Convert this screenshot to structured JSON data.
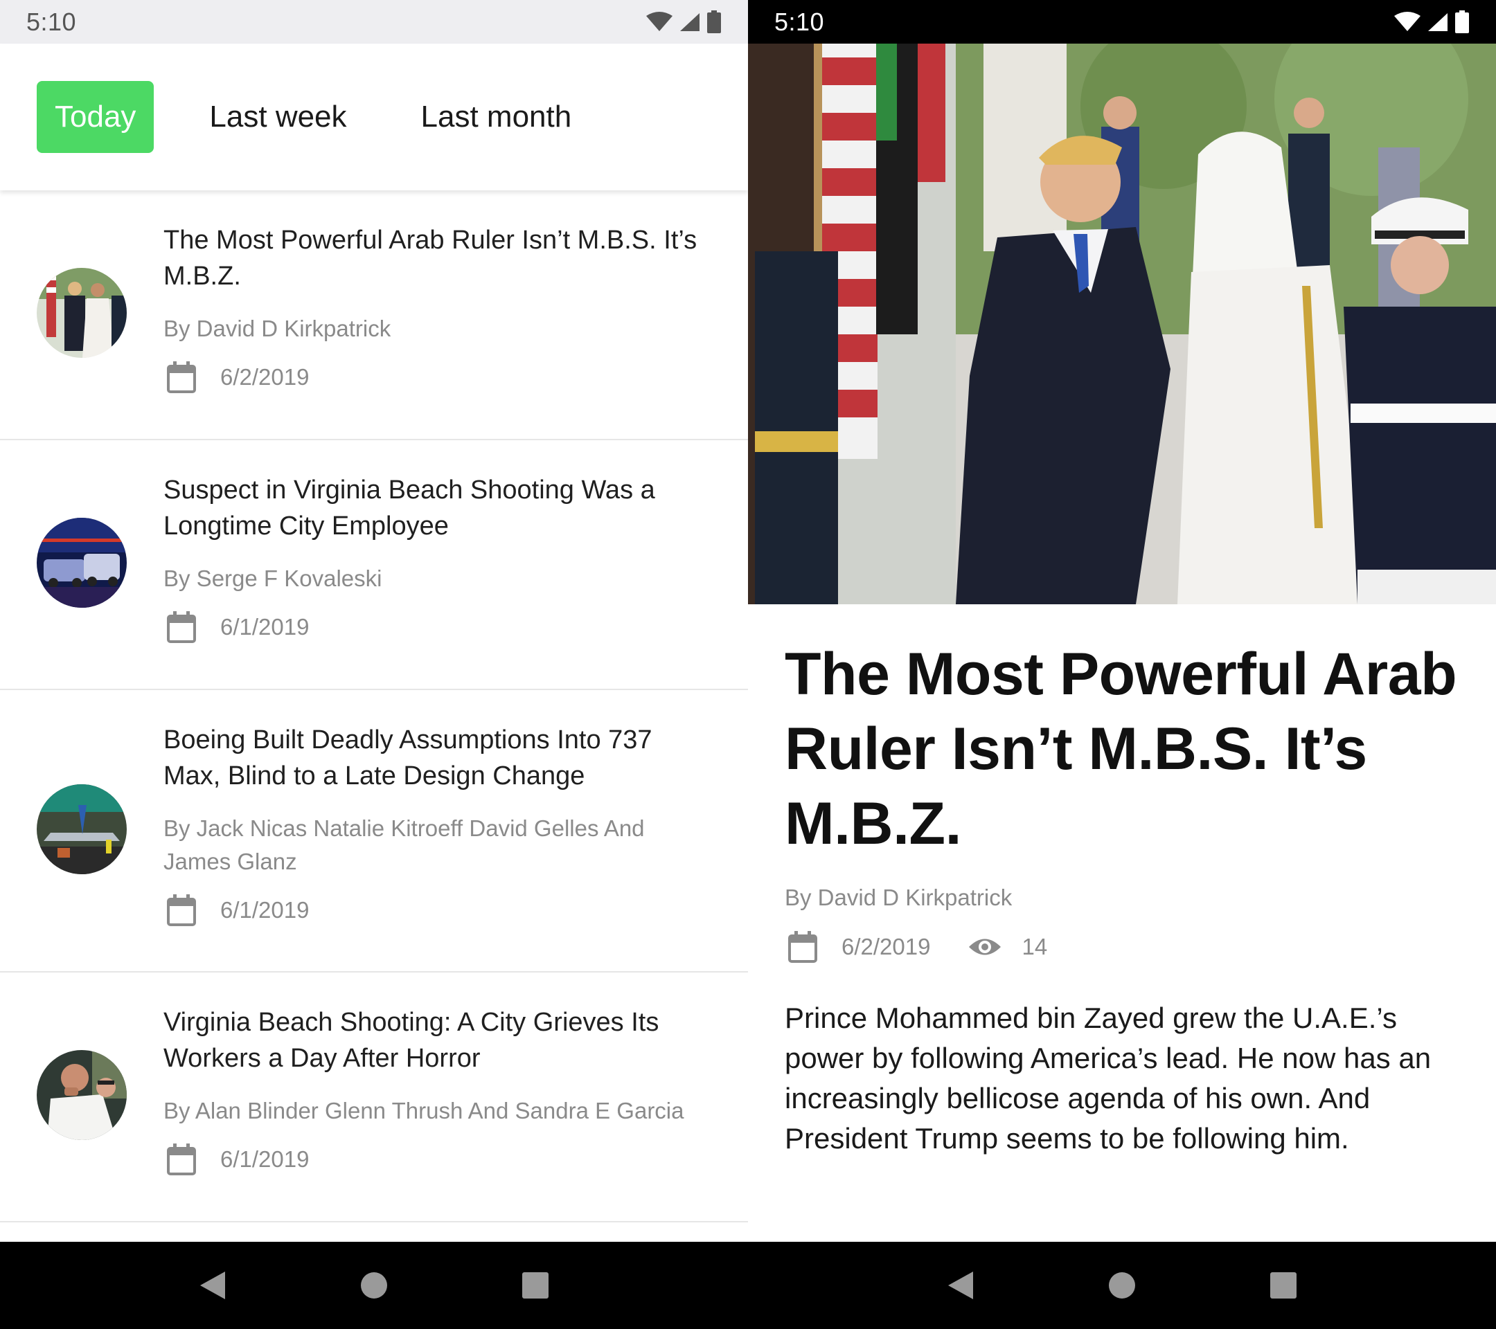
{
  "status_bar": {
    "time": "5:10"
  },
  "filters": {
    "today": "Today",
    "last_week": "Last week",
    "last_month": "Last month",
    "accent": "#4cd964"
  },
  "articles": [
    {
      "title": "The Most Powerful Arab Ruler Isn’t M.B.S. It’s M.B.Z.",
      "author": "By David D Kirkpatrick",
      "date": "6/2/2019"
    },
    {
      "title": "Suspect in Virginia Beach Shooting Was a Longtime City Employee",
      "author": "By Serge F Kovaleski",
      "date": "6/1/2019"
    },
    {
      "title": "Boeing Built Deadly Assumptions Into 737 Max, Blind to a Late Design Change",
      "author": "By Jack Nicas Natalie Kitroeff David Gelles And James Glanz",
      "date": "6/1/2019"
    },
    {
      "title": "Virginia Beach Shooting: A City Grieves Its Workers a Day After Horror",
      "author": "By Alan Blinder Glenn Thrush And Sandra E Garcia",
      "date": "6/1/2019"
    }
  ],
  "detail": {
    "title": "The Most Powerful Arab Ruler Isn’t M.B.S. It’s M.B.Z.",
    "author": "By David D Kirkpatrick",
    "date": "6/2/2019",
    "views": "14",
    "summary": "Prince Mohammed bin Zayed grew the U.A.E.’s power by following America’s lead. He now has an increasingly bellicose agenda of his own. And President Trump seems to be following him."
  },
  "icons": {
    "calendar": "calendar-icon",
    "eye": "eye-icon",
    "wifi": "wifi-icon",
    "signal": "signal-icon",
    "battery": "battery-icon",
    "back": "back-icon",
    "home": "home-icon",
    "recents": "recents-icon"
  }
}
